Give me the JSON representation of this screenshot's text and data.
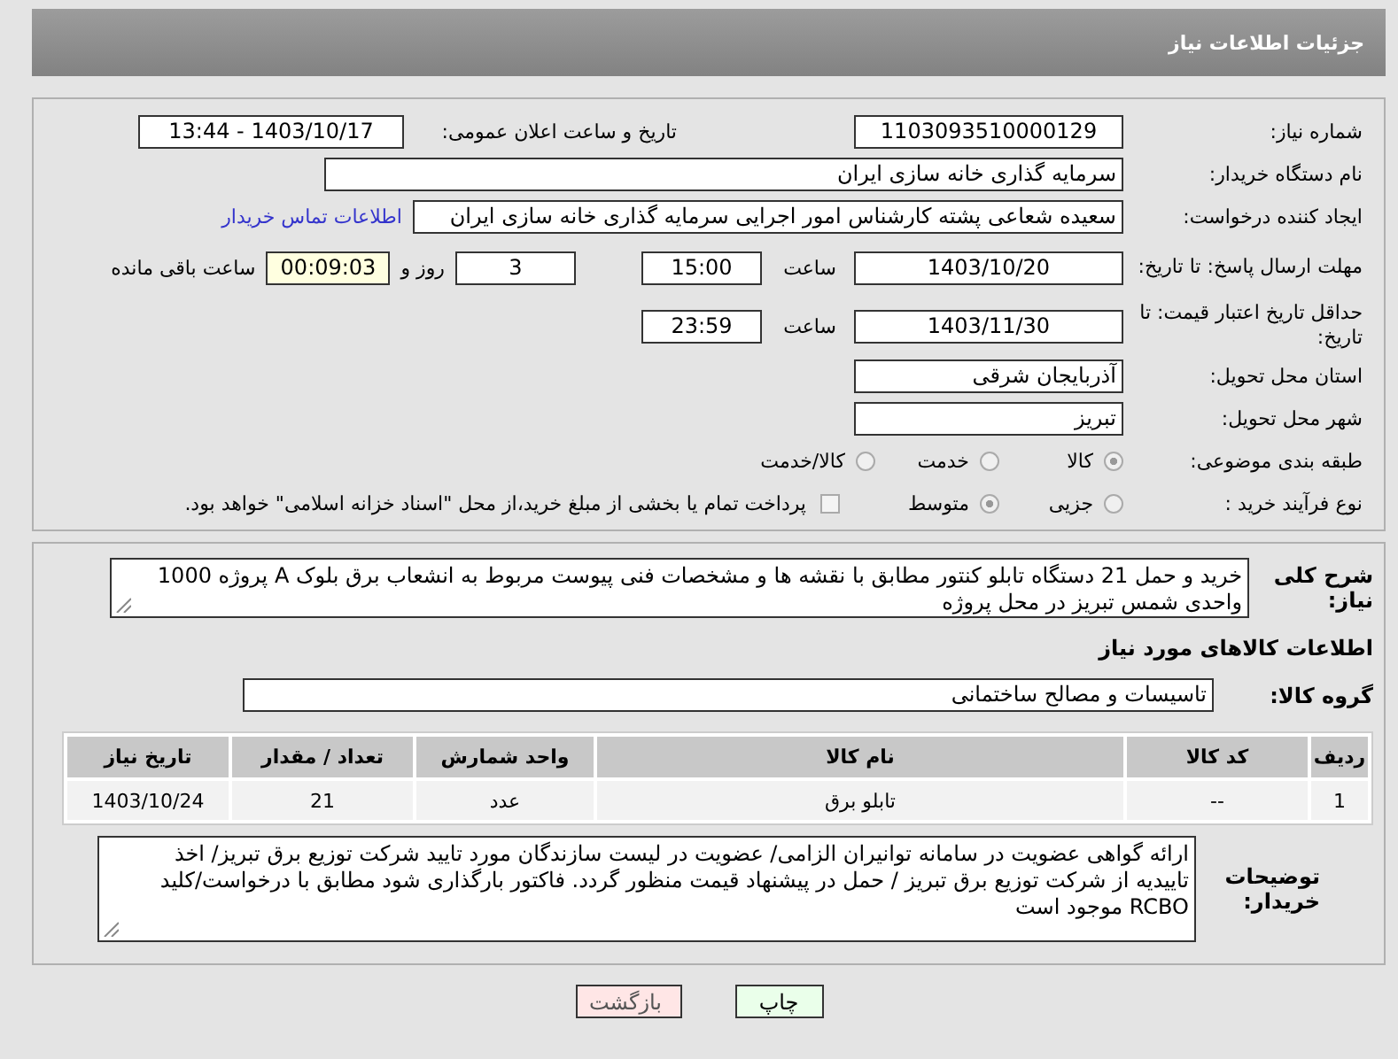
{
  "header": {
    "title": "جزئیات اطلاعات نیاز"
  },
  "need_number": {
    "label": "شماره نیاز:",
    "value": "1103093510000129"
  },
  "announce": {
    "label": "تاریخ و ساعت اعلان عمومی:",
    "value": "1403/10/17 - 13:44"
  },
  "buyer": {
    "label": "نام دستگاه خریدار:",
    "value": "سرمایه گذاری خانه سازی ایران"
  },
  "creator": {
    "label": "ایجاد کننده درخواست:",
    "value": "سعیده شعاعی پشته کارشناس امور اجرایی سرمایه گذاری خانه سازی ایران",
    "link": "اطلاعات تماس خریدار"
  },
  "deadline": {
    "label": "مهلت ارسال پاسخ: تا تاریخ:",
    "date": "1403/10/20",
    "time_label": "ساعت",
    "time": "15:00",
    "days": "3",
    "days_label": "روز و",
    "remaining": "00:09:03",
    "remaining_label": "ساعت باقی مانده"
  },
  "validity": {
    "label": "حداقل تاریخ اعتبار قیمت: تا تاریخ:",
    "date": "1403/11/30",
    "time_label": "ساعت",
    "time": "23:59"
  },
  "province": {
    "label": "استان محل تحویل:",
    "value": "آذربایجان شرقی"
  },
  "city": {
    "label": "شهر محل تحویل:",
    "value": "تبریز"
  },
  "category": {
    "label": "طبقه بندی موضوعی:",
    "options": [
      {
        "label": "کالا",
        "selected": true
      },
      {
        "label": "خدمت",
        "selected": false
      },
      {
        "label": "کالا/خدمت",
        "selected": false
      }
    ]
  },
  "process": {
    "label": "نوع فرآیند خرید :",
    "options": [
      {
        "label": "جزیی",
        "selected": false
      },
      {
        "label": "متوسط",
        "selected": true
      }
    ],
    "payment": {
      "checked": false,
      "label": "پرداخت تمام یا بخشی از مبلغ خرید،از محل \"اسناد خزانه اسلامی\" خواهد بود."
    }
  },
  "description": {
    "label": "شرح کلی نیاز:",
    "value": "خرید و حمل 21 دستگاه تابلو کنتور مطابق با نقشه ها و مشخصات فنی پیوست مربوط به انشعاب برق بلوک A پروژه 1000 واحدی شمس تبریز در محل پروژه"
  },
  "goods_title": "اطلاعات کالاهای مورد نیاز",
  "goods_group": {
    "label": "گروه کالا:",
    "value": "تاسیسات و مصالح ساختمانی"
  },
  "table": {
    "columns": [
      "ردیف",
      "کد کالا",
      "نام کالا",
      "واحد شمارش",
      "تعداد / مقدار",
      "تاریخ نیاز"
    ],
    "rows": [
      [
        "1",
        "--",
        "تابلو برق",
        "عدد",
        "21",
        "1403/10/24"
      ]
    ]
  },
  "buyer_notes": {
    "label": "توضیحات خریدار:",
    "value": "ارائه گواهی عضویت در سامانه توانیران الزامی/ عضویت در لیست سازندگان مورد تایید شرکت توزیع برق تبریز/ اخذ تاییدیه از شرکت توزیع برق تبریز / حمل در پیشنهاد قیمت منظور گردد. فاکتور بارگذاری شود مطابق با درخواست/کلید RCBO موجود است"
  },
  "buttons": [
    {
      "kind": "print",
      "label": "چاپ"
    },
    {
      "kind": "back",
      "label": "بازگشت"
    }
  ]
}
